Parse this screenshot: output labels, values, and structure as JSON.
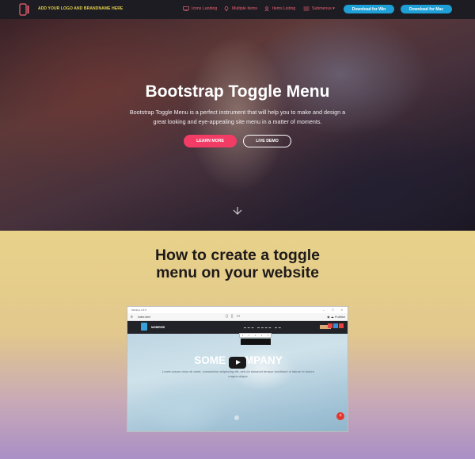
{
  "navbar": {
    "brand": "ADD YOUR LOGO AND BRANDNAME HERE",
    "items": [
      {
        "label": "Icons Landing",
        "icon": "monitor-icon"
      },
      {
        "label": "Multiple Items",
        "icon": "lightbulb-icon"
      },
      {
        "label": "Items Listing",
        "icon": "user-icon"
      },
      {
        "label": "Submenus ▾",
        "icon": "list-icon"
      }
    ],
    "download_win": "Download for Win",
    "download_mac": "Download for Mac",
    "accent": "#f06272",
    "button_color": "#1e9fd6"
  },
  "hero": {
    "title": "Bootstrap Toggle Menu",
    "subtitle": "Bootstrap Toggle Menu is a perfect instrument that will help you to make and design a great looking and eye-appealing site menu in a matter of moments.",
    "learn_more": "LEARN MORE",
    "live_demo": "LIVE DEMO",
    "primary_color": "#f23c66"
  },
  "section": {
    "title": "How to create a toggle menu on your website"
  },
  "video": {
    "window_title": "Mobirise 3.9.5",
    "file_name": "index.html",
    "publish": "Publish",
    "site_brand": "MOBIRISE",
    "mock_title": "SOME COMPANY",
    "mock_text": "Lorem ipsum dolor sit amet, consectetur adipiscing elit, sed do eiusmod tempor incididunt ut labore et dolore magna aliqua."
  }
}
